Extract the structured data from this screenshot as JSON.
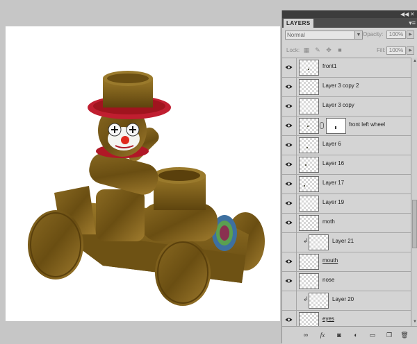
{
  "panel": {
    "title": "LAYERS",
    "blend_mode": "Normal",
    "opacity_label": "Opacity:",
    "opacity_value": "100%",
    "lock_label": "Lock:",
    "fill_label": "Fill:",
    "fill_value": "100%"
  },
  "layers": [
    {
      "name": "front1",
      "visible": true
    },
    {
      "name": "Layer 3 copy 2",
      "visible": true
    },
    {
      "name": "Layer 3 copy",
      "visible": true
    },
    {
      "name": "front left wheel",
      "visible": true
    },
    {
      "name": "Layer 6",
      "visible": true
    },
    {
      "name": "Layer 16",
      "visible": true
    },
    {
      "name": "Layer 17",
      "visible": true
    },
    {
      "name": "Layer 19",
      "visible": true
    },
    {
      "name": "moth",
      "visible": true
    },
    {
      "name": "Layer 21",
      "visible": false
    },
    {
      "name": "mouth",
      "visible": true
    },
    {
      "name": "nose",
      "visible": true
    },
    {
      "name": "Layer 20",
      "visible": false
    },
    {
      "name": "eyes",
      "visible": true
    }
  ],
  "icons": {
    "panel_top": [
      "collapse-icon",
      "close-icon"
    ],
    "panel_menu": "panel-menu-icon",
    "lock": [
      "lock-transparent-icon",
      "lock-image-icon",
      "lock-position-icon",
      "lock-all-icon"
    ],
    "bottom": [
      "link-layers-icon",
      "fx-icon",
      "add-mask-icon",
      "adjustment-layer-icon",
      "new-group-icon",
      "new-layer-icon",
      "trash-icon"
    ]
  },
  "colors": {
    "wood": "#7a5a18",
    "hat_band": "#b8182a",
    "clown_nose": "#e0281c",
    "panel_bg": "#d4d4d4"
  }
}
